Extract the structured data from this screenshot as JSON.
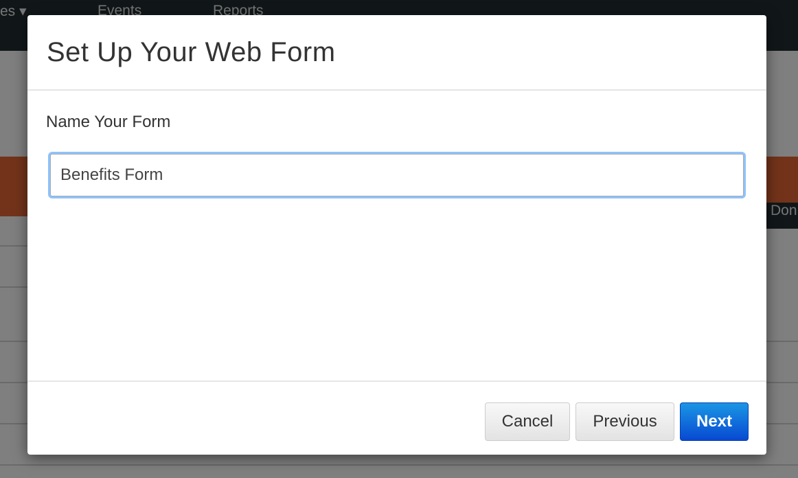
{
  "nav": {
    "items": [
      "es ▾",
      "Events",
      "Reports"
    ]
  },
  "background": {
    "button_partial": "Don"
  },
  "modal": {
    "title": "Set Up Your Web Form",
    "field_label": "Name Your Form",
    "form_name_value": "Benefits Form",
    "buttons": {
      "cancel": "Cancel",
      "previous": "Previous",
      "next": "Next"
    }
  }
}
